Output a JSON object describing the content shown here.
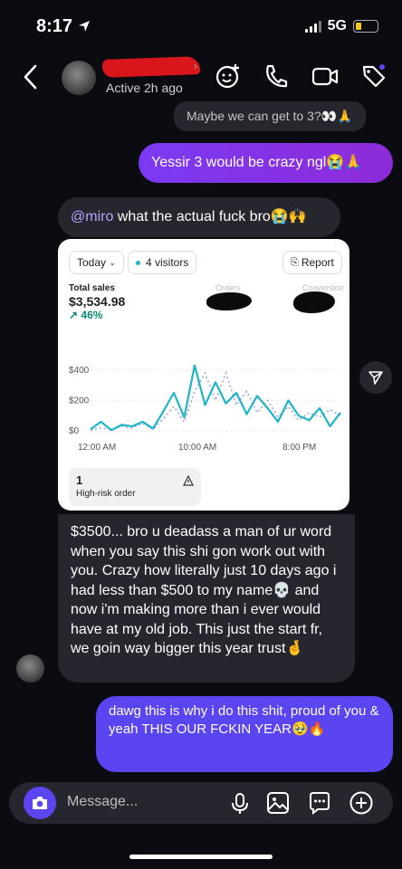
{
  "status_bar": {
    "time": "8:17",
    "network": "5G"
  },
  "header": {
    "active_status": "Active 2h ago"
  },
  "messages": {
    "m1": "Maybe we can get to 3?👀🙏",
    "m2": "Yessir 3 would be crazy ngl😭🙏",
    "m3_mention": "@miro",
    "m3_text": " what the actual fuck bro😭🙌",
    "m4": "$3500... bro u deadass a man of ur word when you say this shi gon work out with you. Crazy how literally just 10 days ago i had less than $500 to my name💀 and now i'm making more than i ever would have at my old job. This just the start fr, we goin way bigger this year trust🤞",
    "m5": "dawg this is why i do this shit, proud of you & yeah THIS OUR FCKIN YEAR🥹🔥"
  },
  "card": {
    "date_filter": "Today",
    "visitors": "4 visitors",
    "report_label": "Report",
    "total_sales_label": "Total sales",
    "total_sales_value": "$3,534.98",
    "total_sales_change": "46%",
    "orders_label": "Orders",
    "conversion_label": "Conversion",
    "risk_count": "1",
    "risk_label": "High-risk order"
  },
  "chart_data": {
    "type": "line",
    "x_ticks": [
      "12:00 AM",
      "10:00 AM",
      "8:00 PM"
    ],
    "y_ticks": [
      "$400",
      "$200",
      "$0"
    ],
    "ylim": [
      0,
      500
    ],
    "series": [
      {
        "style": "solid",
        "color": "#1fb5c9",
        "x": [
          0,
          1,
          2,
          3,
          4,
          5,
          6,
          7,
          8,
          9,
          10,
          11,
          12,
          13,
          14,
          15,
          16,
          17,
          18,
          19,
          20,
          21,
          22,
          23,
          24
        ],
        "values": [
          10,
          60,
          5,
          40,
          30,
          60,
          15,
          130,
          250,
          90,
          430,
          170,
          320,
          180,
          250,
          110,
          230,
          150,
          60,
          200,
          100,
          70,
          150,
          30,
          120
        ]
      },
      {
        "style": "dotted",
        "color": "#9aa7d6",
        "x": [
          0,
          1,
          2,
          3,
          4,
          5,
          6,
          7,
          8,
          9,
          10,
          11,
          12,
          13,
          14,
          15,
          16,
          17,
          18,
          19,
          20,
          21,
          22,
          23,
          24
        ],
        "values": [
          5,
          20,
          10,
          30,
          20,
          50,
          10,
          80,
          160,
          60,
          260,
          380,
          200,
          380,
          170,
          260,
          120,
          200,
          90,
          160,
          70,
          120,
          90,
          140,
          100
        ]
      }
    ]
  },
  "composer": {
    "placeholder": "Message..."
  },
  "colors": {
    "background": "#0b0b12",
    "incoming": "#26262e",
    "outgoing_gradient": "#7b3af2",
    "outgoing2": "#5b45f0",
    "chart_line": "#1fb5c9"
  },
  "icons": [
    "chevron-left-icon",
    "emoji-add-icon",
    "phone-icon",
    "video-icon",
    "tag-heart-icon",
    "share-icon",
    "camera-icon",
    "microphone-icon",
    "image-icon",
    "sticker-icon",
    "plus-circle-icon",
    "alert-icon",
    "arrow-up-right-icon"
  ]
}
